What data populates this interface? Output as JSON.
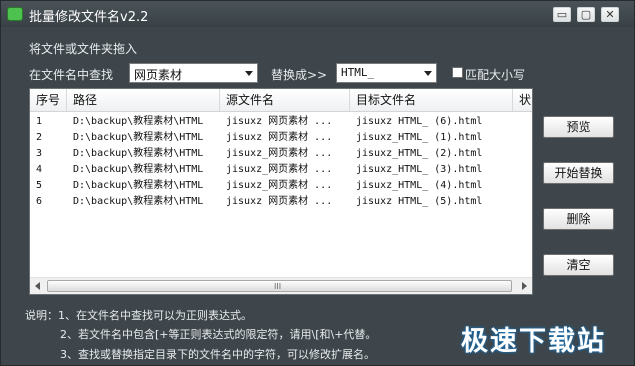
{
  "window": {
    "title": "批量修改文件名v2.2",
    "min_glyph": "▭",
    "max_glyph": "▢",
    "close_glyph": "✕"
  },
  "form": {
    "drop_hint": "将文件或文件夹拖入",
    "search_label": "在文件名中查找",
    "search_value": "网页素材",
    "replace_label": "替换成>>",
    "replace_value": "HTML_",
    "match_case_label": "匹配大小写"
  },
  "table": {
    "columns": [
      "序号",
      "路径",
      "源文件名",
      "目标文件名",
      "状"
    ],
    "rows": [
      {
        "no": "1",
        "path": "D:\\backup\\教程素材\\HTML",
        "source": "jisuxz 网页素材 ...",
        "target": "jisuxz HTML_ (6).html"
      },
      {
        "no": "2",
        "path": "D:\\backup\\教程素材\\HTML",
        "source": "jisuxz 网页素材 ...",
        "target": "jisuxz_HTML_ (1).html"
      },
      {
        "no": "3",
        "path": "D:\\backup\\教程素材\\HTML",
        "source": "jisuxz_网页素材 ...",
        "target": "jisuxz_HTML_ (2).html"
      },
      {
        "no": "4",
        "path": "D:\\backup\\教程素材\\HTML",
        "source": "jisuxz_网页素材 ...",
        "target": "jisuxz_HTML_ (3).html"
      },
      {
        "no": "5",
        "path": "D:\\backup\\教程素材\\HTML",
        "source": "jisuxz_网页素材 ...",
        "target": "jisuxz_HTML_ (4).html"
      },
      {
        "no": "6",
        "path": "D:\\backup\\教程素材\\HTML",
        "source": "jisuxz 网页素材 ...",
        "target": "jisuxz HTML_ (5).html"
      }
    ],
    "scroll_grip": "III"
  },
  "actions": {
    "preview": "预览",
    "start": "开始替换",
    "delete": "删除",
    "clear": "清空"
  },
  "notes": [
    "说明：1、在文件名中查找可以为正则表达式。",
    "2、若文件名中包含[+等正则表达式的限定符，请用\\[和\\+代替。",
    "3、查找或替换指定目录下的文件名中的字符，可以修改扩展名。"
  ],
  "watermark": "极速下载站",
  "colors": {
    "window_bg": "#3e464b",
    "titlebar": "#394146",
    "icon_green": "#4ec24e",
    "watermark_glow": "#1a6fb0"
  }
}
